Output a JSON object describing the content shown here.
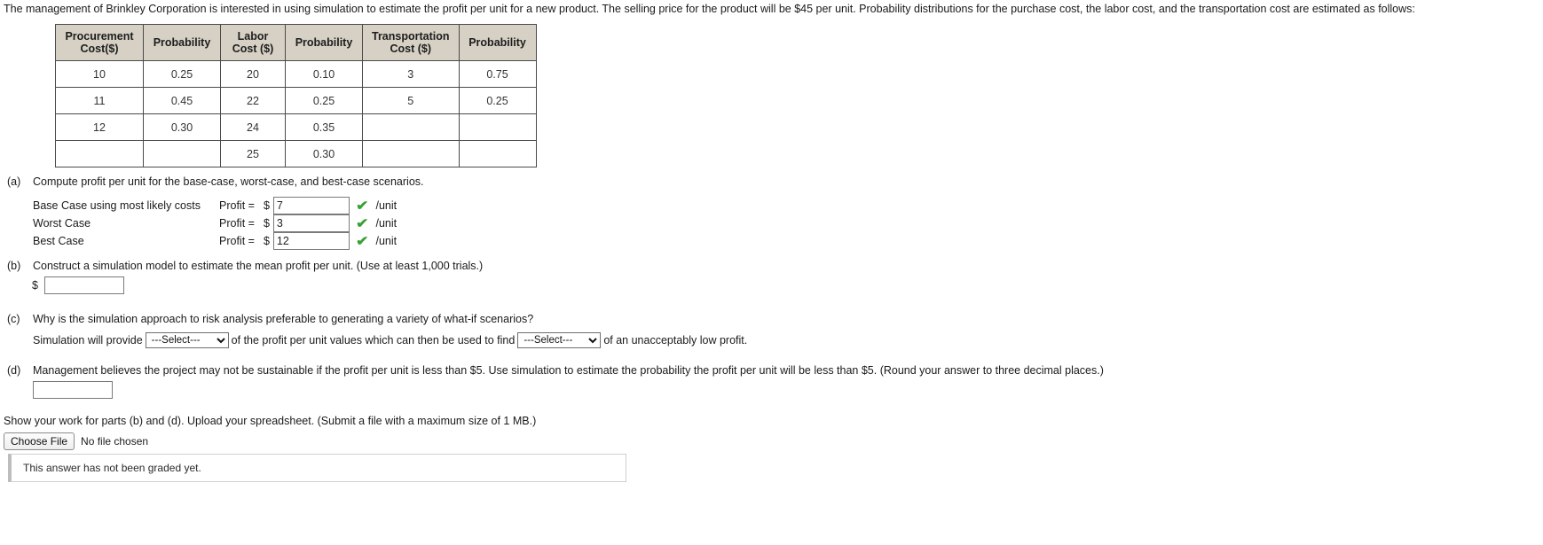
{
  "intro": "The management of Brinkley Corporation is interested in using simulation to estimate the profit per unit for a new product. The selling price for the product will be $45 per unit. Probability distributions for the purchase cost, the labor cost, and the transportation cost are estimated as follows:",
  "table": {
    "headers": [
      "Procurement Cost($)",
      "Probability",
      "Labor Cost ($)",
      "Probability",
      "Transportation Cost ($)",
      "Probability"
    ],
    "headers_lines": [
      [
        "Procurement",
        "Cost($)"
      ],
      [
        "Probability",
        ""
      ],
      [
        "Labor",
        "Cost ($)"
      ],
      [
        "Probability",
        ""
      ],
      [
        "Transportation",
        "Cost ($)"
      ],
      [
        "Probability",
        ""
      ]
    ],
    "rows": [
      [
        "10",
        "0.25",
        "20",
        "0.10",
        "3",
        "0.75"
      ],
      [
        "11",
        "0.45",
        "22",
        "0.25",
        "5",
        "0.25"
      ],
      [
        "12",
        "0.30",
        "24",
        "0.35",
        "",
        ""
      ],
      [
        "",
        "",
        "25",
        "0.30",
        "",
        ""
      ]
    ]
  },
  "parts": {
    "a": {
      "label": "(a)",
      "text": "Compute profit per unit for the base-case, worst-case, and best-case scenarios.",
      "rows": [
        {
          "scenario": "Base Case using most likely costs",
          "profit_label": "Profit =",
          "dollar": "$",
          "value": "7",
          "status": "correct",
          "unit": "/unit"
        },
        {
          "scenario": "Worst Case",
          "profit_label": "Profit =",
          "dollar": "$",
          "value": "3",
          "status": "correct",
          "unit": "/unit"
        },
        {
          "scenario": "Best Case",
          "profit_label": "Profit =",
          "dollar": "$",
          "value": "12",
          "status": "correct",
          "unit": "/unit"
        }
      ],
      "check_glyph": "✔"
    },
    "b": {
      "label": "(b)",
      "text": "Construct a simulation model to estimate the mean profit per unit. (Use at least 1,000 trials.)",
      "dollar": "$",
      "value": "",
      "placeholder": ""
    },
    "c": {
      "label": "(c)",
      "text": "Why is the simulation approach to risk analysis preferable to generating a variety of what-if scenarios?",
      "sentence_part1": "Simulation will provide",
      "select1_value": "---Select---",
      "sentence_part2": "of the profit per unit values which can then be used to find",
      "select2_value": "---Select---",
      "sentence_part3": "of an unacceptably low profit."
    },
    "d": {
      "label": "(d)",
      "text": "Management believes the project may not be sustainable if the profit per unit is less than $5. Use simulation to estimate the probability the profit per unit will be less than $5. (Round your answer to three decimal places.)",
      "value": "",
      "placeholder": ""
    }
  },
  "upload": {
    "instruction": "Show your work for parts (b) and (d). Upload your spreadsheet. (Submit a file with a maximum size of 1 MB.)",
    "choose_file_label": "Choose File",
    "no_file_label": "No file chosen"
  },
  "status": {
    "graded_message": "This answer has not been graded yet."
  },
  "colors": {
    "table_header_bg": "#d6d1c4",
    "check_green": "#3aa135",
    "border_gray": "#4a4a4a"
  }
}
